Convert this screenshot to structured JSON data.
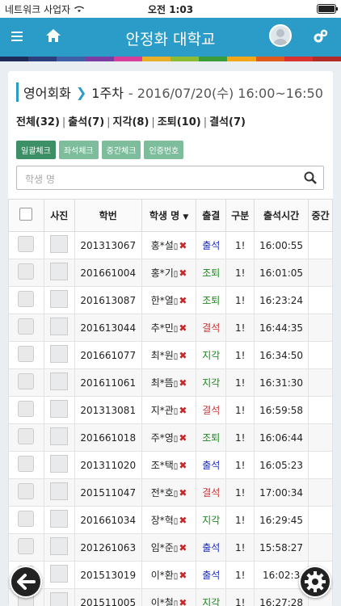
{
  "statusbar": {
    "carrier": "네트워크 사업자",
    "time": "오전 1:03"
  },
  "header": {
    "title": "안정화 대학교"
  },
  "colors": {
    "nav": "#2b9bc7",
    "rainbow": [
      "#1f2b57",
      "#2c3f7c",
      "#3f5fa6",
      "#7a3ea3",
      "#d63e9a",
      "#e8b02a",
      "#8dbb33",
      "#3a9c3b",
      "#f2a71b",
      "#e05a1c",
      "#d7322f",
      "#b32b29"
    ]
  },
  "lecture": {
    "course": "영어회화",
    "week": "1주차",
    "schedule": "- 2016/07/20(수) 16:00~16:50"
  },
  "summary": {
    "total": "전체(32)",
    "present": "출석(7)",
    "late": "지각(8)",
    "early": "조퇴(10)",
    "absent": "결석(7)"
  },
  "buttons": {
    "bulk": "일괄체크",
    "seat": "좌석체크",
    "mid": "중간체크",
    "auth": "인증번호"
  },
  "search": {
    "placeholder": "학생 명"
  },
  "table": {
    "headers": {
      "photo": "사진",
      "id": "학번",
      "name": "학생 명",
      "attendance": "출결",
      "type": "구분",
      "time": "출석시간",
      "mid": "중간"
    },
    "rows": [
      {
        "id": "201313067",
        "name": "홍*설",
        "att": "출석",
        "cls": "status-ok",
        "type": "1!",
        "time": "16:00:55"
      },
      {
        "id": "201661004",
        "name": "홍*기",
        "att": "조퇴",
        "cls": "status-early",
        "type": "1!",
        "time": "16:01:05"
      },
      {
        "id": "201613087",
        "name": "한*열",
        "att": "조퇴",
        "cls": "status-early",
        "type": "1!",
        "time": "16:23:24"
      },
      {
        "id": "201613044",
        "name": "추*민",
        "att": "결석",
        "cls": "status-absent",
        "type": "1!",
        "time": "16:44:35"
      },
      {
        "id": "201661077",
        "name": "최*원",
        "att": "지각",
        "cls": "status-late",
        "type": "1!",
        "time": "16:34:50"
      },
      {
        "id": "201611061",
        "name": "최*뜸",
        "att": "지각",
        "cls": "status-late",
        "type": "1!",
        "time": "16:31:30"
      },
      {
        "id": "201313081",
        "name": "지*관",
        "att": "결석",
        "cls": "status-absent",
        "type": "1!",
        "time": "16:59:58"
      },
      {
        "id": "201661018",
        "name": "주*영",
        "att": "조퇴",
        "cls": "status-early",
        "type": "1!",
        "time": "16:06:44"
      },
      {
        "id": "201311020",
        "name": "조*택",
        "att": "출석",
        "cls": "status-ok",
        "type": "1!",
        "time": "16:05:23"
      },
      {
        "id": "201511047",
        "name": "전*호",
        "att": "결석",
        "cls": "status-absent",
        "type": "1!",
        "time": "17:00:34"
      },
      {
        "id": "201661034",
        "name": "장*혁",
        "att": "지각",
        "cls": "status-late",
        "type": "1!",
        "time": "16:29:45"
      },
      {
        "id": "201261063",
        "name": "임*준",
        "att": "출석",
        "cls": "status-ok",
        "type": "1!",
        "time": "15:58:27"
      },
      {
        "id": "201513019",
        "name": "이*환",
        "att": "출석",
        "cls": "status-ok",
        "type": "1!",
        "time": "16:02:3"
      },
      {
        "id": "201511005",
        "name": "이*철",
        "att": "지각",
        "cls": "status-late",
        "type": "1!",
        "time": "16:27:28"
      }
    ]
  }
}
